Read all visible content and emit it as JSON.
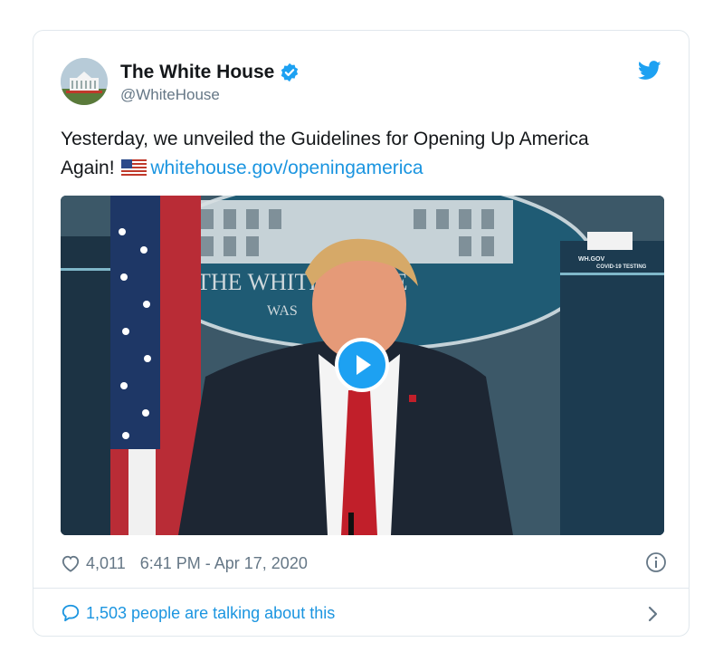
{
  "tweet": {
    "name": "The White House",
    "handle": "@WhiteHouse",
    "text_line1": "Yesterday, we unveiled the Guidelines for Opening Up America",
    "text_line2": "Again!",
    "link": "whitehouse.gov/openingamerica"
  },
  "media": {
    "podium_text_1": "THE WHITE HOUSE",
    "podium_text_2": "WAS",
    "screen_text_1": "WH.GOV",
    "screen_text_2": "COVID-19 TESTING"
  },
  "footer": {
    "likes": "4,011",
    "timestamp": "6:41 PM - Apr 17, 2020",
    "talking": "1,503 people are talking about this"
  },
  "colors": {
    "accent": "#1da1f2",
    "link": "#1b95e0",
    "muted": "#657786",
    "border": "#e1e8ed"
  },
  "icons": [
    "verified-badge-icon",
    "twitter-bird-icon",
    "heart-icon",
    "info-icon",
    "comment-bubble-icon",
    "chevron-right-icon",
    "play-icon",
    "us-flag-icon"
  ]
}
